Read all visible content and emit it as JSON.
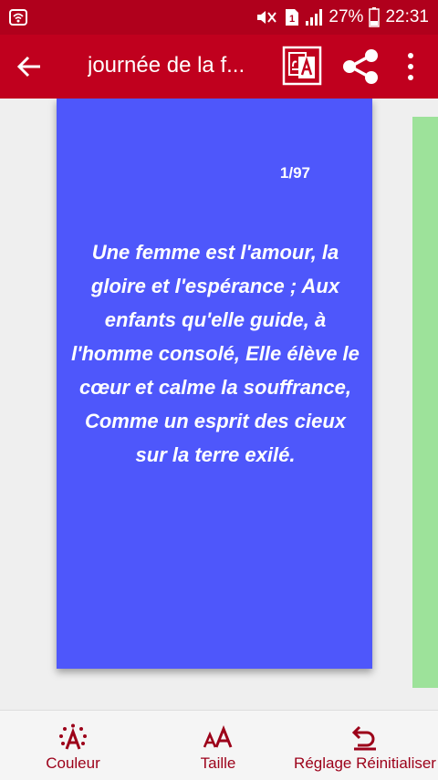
{
  "status": {
    "battery_percent": "27%",
    "time": "22:31",
    "sim_label": "1"
  },
  "appbar": {
    "title": "journée de la f..."
  },
  "card": {
    "counter": "1/97",
    "quote": "Une femme est l'amour, la gloire et l'espérance ; Aux enfants qu'elle guide, à l'homme consolé, Elle élève le cœur et calme la souffrance, Comme un esprit des cieux sur la terre exilé.",
    "color": "#4e57fb"
  },
  "next_card": {
    "color": "#9de29a"
  },
  "bottom_nav": {
    "color_label": "Couleur",
    "size_label": "Taille",
    "reset_label": "Réglage Réinitialiser",
    "size_icon_text": "AA"
  },
  "theme": {
    "primary": "#c0001e",
    "accent": "#9c0019"
  }
}
